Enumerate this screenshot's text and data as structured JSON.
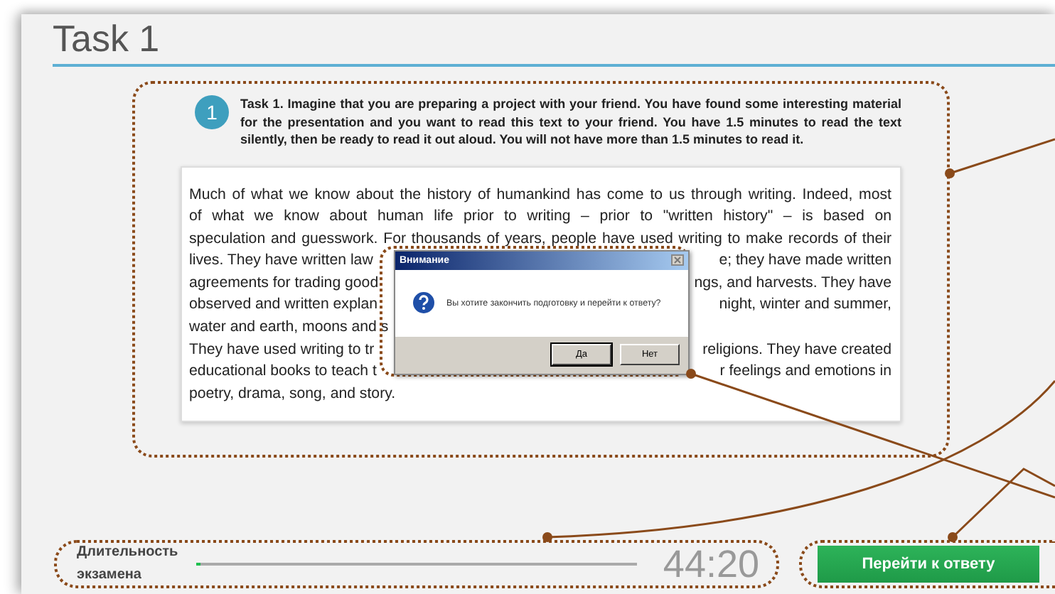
{
  "window": {
    "title": "Task 1"
  },
  "task": {
    "number": "1",
    "instruction": "Task 1. Imagine that you are preparing a project with your friend. You have found some interesting material for the presentation and you want to read this text to your friend. You have 1.5 minutes to read the text silently, then be ready to read it out aloud. You will not have more than 1.5 minutes to read it."
  },
  "passage_lines": [
    {
      "left": "Much of what we know about the history of humankind has come to us through writing. Indeed, most"
    },
    {
      "left": "of what we know about human life prior to writing – prior to \"written history\" – is based on"
    },
    {
      "left": "speculation and guesswork. For thousands of years, people have used writing to make records of their"
    },
    {
      "left": "lives. They have written law",
      "right": "e; they have made written"
    },
    {
      "left": "agreements for trading good",
      "right": "ngs, and harvests. They have"
    },
    {
      "left": "observed and written explan",
      "right": "night, winter and summer,"
    },
    {
      "left": "water and earth, moons and s"
    },
    {
      "left": "They have used writing to tr",
      "right": "religions. They have created"
    },
    {
      "left": "educational books to teach t",
      "right": "r feelings and emotions in"
    },
    {
      "left": "poetry, drama, song, and story."
    }
  ],
  "dialog": {
    "title": "Внимание",
    "message": "Вы хотите закончить подготовку и перейти к ответу?",
    "buttons": [
      {
        "label": "Да",
        "focused": true
      },
      {
        "label": "Нет",
        "focused": false
      }
    ]
  },
  "footer": {
    "duration_label": "Длительность экзамена",
    "progress": {
      "level": 0.01
    },
    "timer": "44:20",
    "answer_button": "Перейти к ответу"
  }
}
